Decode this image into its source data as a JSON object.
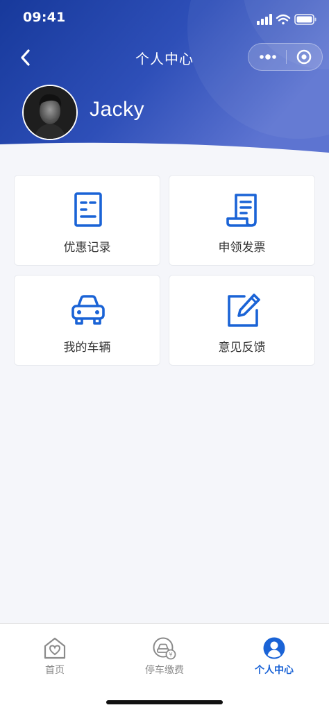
{
  "status_bar": {
    "time": "09:41"
  },
  "nav": {
    "title": "个人中心",
    "back_icon": "chevron-left-icon",
    "more_icon": "more-dots-icon",
    "close_icon": "target-circle-icon"
  },
  "profile": {
    "name": "Jacky",
    "avatar_icon": "user-photo-avatar"
  },
  "menu": {
    "items": [
      {
        "label": "优惠记录",
        "icon": "receipt-list-icon"
      },
      {
        "label": "申领发票",
        "icon": "invoice-scroll-icon"
      },
      {
        "label": "我的车辆",
        "icon": "car-icon"
      },
      {
        "label": "意见反馈",
        "icon": "edit-pencil-icon"
      }
    ]
  },
  "tabbar": {
    "tabs": [
      {
        "label": "首页",
        "icon": "home-heart-icon",
        "active": false
      },
      {
        "label": "停车缴费",
        "icon": "parking-payment-icon",
        "active": false
      },
      {
        "label": "个人中心",
        "icon": "user-profile-icon",
        "active": true
      }
    ]
  },
  "colors": {
    "header_gradient_start": "#1a3a9e",
    "header_gradient_end": "#5a72cf",
    "accent": "#1a63d6",
    "background": "#f5f6fa",
    "tab_inactive": "#8a8a8a"
  }
}
